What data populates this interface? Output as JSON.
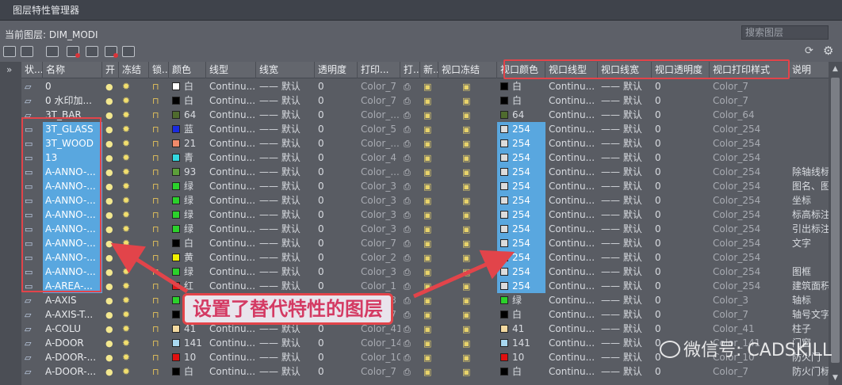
{
  "title": "图层特性管理器",
  "current_layer": "当前图层: DIM_MODI",
  "search_placeholder": "搜索图层",
  "annotation": "设置了替代特性的图层",
  "watermark": "微信号: CADSKILL",
  "columns": [
    {
      "key": "status",
      "label": "状..."
    },
    {
      "key": "name",
      "label": "名称"
    },
    {
      "key": "on",
      "label": "开"
    },
    {
      "key": "freeze",
      "label": "冻结"
    },
    {
      "key": "lock",
      "label": "锁..."
    },
    {
      "key": "color",
      "label": "颜色"
    },
    {
      "key": "linetype",
      "label": "线型"
    },
    {
      "key": "lineweight",
      "label": "线宽"
    },
    {
      "key": "transparency",
      "label": "透明度"
    },
    {
      "key": "plotstyle",
      "label": "打印..."
    },
    {
      "key": "plot",
      "label": "打..."
    },
    {
      "key": "newvp",
      "label": "新..."
    },
    {
      "key": "vpfreeze",
      "label": "视口冻结"
    },
    {
      "key": "vpcolor",
      "label": "视口颜色"
    },
    {
      "key": "vplinetype",
      "label": "视口线型"
    },
    {
      "key": "vplineweight",
      "label": "视口线宽"
    },
    {
      "key": "vptransparency",
      "label": "视口透明度"
    },
    {
      "key": "vpplotstyle",
      "label": "视口打印样式"
    },
    {
      "key": "desc",
      "label": "说明"
    }
  ],
  "rows": [
    {
      "name": "0",
      "override": false,
      "color": "白",
      "color_hex": "#ffffff",
      "linetype": "Continu...",
      "lineweight": "—— 默认",
      "transparency": "0",
      "plotstyle": "Color_7",
      "vpcolor": "白",
      "vpcolor_hex": "#000000",
      "vplinetype": "Continu...",
      "vplineweight": "—— 默认",
      "vptransparency": "0",
      "vpplotstyle": "Color_7",
      "desc": ""
    },
    {
      "name": "0 水印加...",
      "override": false,
      "color": "白",
      "color_hex": "#000000",
      "linetype": "Continu...",
      "lineweight": "—— 默认",
      "transparency": "0",
      "plotstyle": "Color_7",
      "vpcolor": "白",
      "vpcolor_hex": "#000000",
      "vplinetype": "Continu...",
      "vplineweight": "—— 默认",
      "vptransparency": "0",
      "vpplotstyle": "Color_7",
      "desc": ""
    },
    {
      "name": "3T_BAR",
      "override": false,
      "color": "64",
      "color_hex": "#4f6b2e",
      "linetype": "Continu...",
      "lineweight": "—— 默认",
      "transparency": "0",
      "plotstyle": "Color_...",
      "vpcolor": "64",
      "vpcolor_hex": "#4f6b2e",
      "vplinetype": "Continu...",
      "vplineweight": "—— 默认",
      "vptransparency": "0",
      "vpplotstyle": "Color_64",
      "desc": ""
    },
    {
      "name": "3T_GLASS",
      "override": true,
      "color": "蓝",
      "color_hex": "#1a2be0",
      "linetype": "Continu...",
      "lineweight": "—— 默认",
      "transparency": "0",
      "plotstyle": "Color_5",
      "vpcolor": "254",
      "vpcolor_hex": "#dcdcdc",
      "vplinetype": "Continu...",
      "vplineweight": "—— 默认",
      "vptransparency": "0",
      "vpplotstyle": "Color_254",
      "desc": ""
    },
    {
      "name": "3T_WOOD",
      "override": true,
      "color": "21",
      "color_hex": "#f08a6a",
      "linetype": "Continu...",
      "lineweight": "—— 默认",
      "transparency": "0",
      "plotstyle": "Color_...",
      "vpcolor": "254",
      "vpcolor_hex": "#dcdcdc",
      "vplinetype": "Continu...",
      "vplineweight": "—— 默认",
      "vptransparency": "0",
      "vpplotstyle": "Color_254",
      "desc": ""
    },
    {
      "name": "13",
      "override": true,
      "color": "青",
      "color_hex": "#33d8e0",
      "linetype": "Continu...",
      "lineweight": "—— 默认",
      "transparency": "0",
      "plotstyle": "Color_4",
      "vpcolor": "254",
      "vpcolor_hex": "#dcdcdc",
      "vplinetype": "Continu...",
      "vplineweight": "—— 默认",
      "vptransparency": "0",
      "vpplotstyle": "Color_254",
      "desc": ""
    },
    {
      "name": "A-ANNO-...",
      "override": true,
      "color": "93",
      "color_hex": "#5c9f3a",
      "linetype": "Continu...",
      "lineweight": "—— 默认",
      "transparency": "0",
      "plotstyle": "Color_...",
      "vpcolor": "254",
      "vpcolor_hex": "#dcdcdc",
      "vplinetype": "Continu...",
      "vplineweight": "—— 默认",
      "vptransparency": "0",
      "vpplotstyle": "Color_254",
      "desc": "除轴线标"
    },
    {
      "name": "A-ANNO-...",
      "override": true,
      "color": "绿",
      "color_hex": "#2bd12b",
      "linetype": "Continu...",
      "lineweight": "—— 默认",
      "transparency": "0",
      "plotstyle": "Color_3",
      "vpcolor": "254",
      "vpcolor_hex": "#dcdcdc",
      "vplinetype": "Continu...",
      "vplineweight": "—— 默认",
      "vptransparency": "0",
      "vpplotstyle": "Color_254",
      "desc": "图名、图"
    },
    {
      "name": "A-ANNO-...",
      "override": true,
      "color": "绿",
      "color_hex": "#2bd12b",
      "linetype": "Continu...",
      "lineweight": "—— 默认",
      "transparency": "0",
      "plotstyle": "Color_3",
      "vpcolor": "254",
      "vpcolor_hex": "#dcdcdc",
      "vplinetype": "Continu...",
      "vplineweight": "—— 默认",
      "vptransparency": "0",
      "vpplotstyle": "Color_254",
      "desc": "坐标"
    },
    {
      "name": "A-ANNO-...",
      "override": true,
      "color": "绿",
      "color_hex": "#2bd12b",
      "linetype": "Continu...",
      "lineweight": "—— 默认",
      "transparency": "0",
      "plotstyle": "Color_3",
      "vpcolor": "254",
      "vpcolor_hex": "#dcdcdc",
      "vplinetype": "Continu...",
      "vplineweight": "—— 默认",
      "vptransparency": "0",
      "vpplotstyle": "Color_254",
      "desc": "标高标注"
    },
    {
      "name": "A-ANNO-...",
      "override": true,
      "color": "绿",
      "color_hex": "#2bd12b",
      "linetype": "Continu...",
      "lineweight": "—— 默认",
      "transparency": "0",
      "plotstyle": "Color_3",
      "vpcolor": "254",
      "vpcolor_hex": "#dcdcdc",
      "vplinetype": "Continu...",
      "vplineweight": "—— 默认",
      "vptransparency": "0",
      "vpplotstyle": "Color_254",
      "desc": "引出标注"
    },
    {
      "name": "A-ANNO-...",
      "override": true,
      "color": "白",
      "color_hex": "#000000",
      "linetype": "Continu...",
      "lineweight": "—— 默认",
      "transparency": "0",
      "plotstyle": "Color_7",
      "vpcolor": "254",
      "vpcolor_hex": "#dcdcdc",
      "vplinetype": "Continu...",
      "vplineweight": "—— 默认",
      "vptransparency": "0",
      "vpplotstyle": "Color_254",
      "desc": "文字"
    },
    {
      "name": "A-ANNO-...",
      "override": true,
      "color": "黄",
      "color_hex": "#f0f000",
      "linetype": "Continu...",
      "lineweight": "—— 默认",
      "transparency": "0",
      "plotstyle": "Color_2",
      "vpcolor": "254",
      "vpcolor_hex": "#dcdcdc",
      "vplinetype": "Continu...",
      "vplineweight": "—— 默认",
      "vptransparency": "0",
      "vpplotstyle": "Color_254",
      "desc": ""
    },
    {
      "name": "A-ANNO-...",
      "override": true,
      "color": "绿",
      "color_hex": "#2bd12b",
      "linetype": "Continu...",
      "lineweight": "—— 默认",
      "transparency": "0",
      "plotstyle": "Color_3",
      "vpcolor": "254",
      "vpcolor_hex": "#dcdcdc",
      "vplinetype": "Continu...",
      "vplineweight": "—— 默认",
      "vptransparency": "0",
      "vpplotstyle": "Color_254",
      "desc": "图框"
    },
    {
      "name": "A-AREA-...",
      "override": true,
      "color": "红",
      "color_hex": "#e01a1a",
      "linetype": "Continu...",
      "lineweight": "—— 默认",
      "transparency": "0",
      "plotstyle": "Color_1",
      "vpcolor": "254",
      "vpcolor_hex": "#dcdcdc",
      "vplinetype": "Continu...",
      "vplineweight": "—— 默认",
      "vptransparency": "0",
      "vpplotstyle": "Color_254",
      "desc": "建筑面积"
    },
    {
      "name": "A-AXIS",
      "override": false,
      "color": "绿",
      "color_hex": "#2bd12b",
      "linetype": "Continu...",
      "lineweight": "—— 默认",
      "transparency": "0",
      "plotstyle": "Color_3",
      "vpcolor": "绿",
      "vpcolor_hex": "#2bd12b",
      "vplinetype": "Continu...",
      "vplineweight": "—— 默认",
      "vptransparency": "0",
      "vpplotstyle": "Color_3",
      "desc": "轴标"
    },
    {
      "name": "A-AXIS-T...",
      "override": false,
      "color": "白",
      "color_hex": "#000000",
      "linetype": "Continu...",
      "lineweight": "—— 默认",
      "transparency": "0",
      "plotstyle": "Color_7",
      "vpcolor": "白",
      "vpcolor_hex": "#000000",
      "vplinetype": "Continu...",
      "vplineweight": "—— 默认",
      "vptransparency": "0",
      "vpplotstyle": "Color_7",
      "desc": "轴号文字"
    },
    {
      "name": "A-COLU",
      "override": false,
      "color": "41",
      "color_hex": "#f3d9a0",
      "linetype": "Continu...",
      "lineweight": "—— 默认",
      "transparency": "0",
      "plotstyle": "Color_41",
      "vpcolor": "41",
      "vpcolor_hex": "#f3d9a0",
      "vplinetype": "Continu...",
      "vplineweight": "—— 默认",
      "vptransparency": "0",
      "vpplotstyle": "Color_41",
      "desc": "柱子"
    },
    {
      "name": "A-DOOR",
      "override": false,
      "color": "141",
      "color_hex": "#a8d8f0",
      "linetype": "Continu...",
      "lineweight": "—— 默认",
      "transparency": "0",
      "plotstyle": "Color_141",
      "vpcolor": "141",
      "vpcolor_hex": "#a8d8f0",
      "vplinetype": "Continu...",
      "vplineweight": "—— 默认",
      "vptransparency": "0",
      "vpplotstyle": "Color_141",
      "desc": "门窗"
    },
    {
      "name": "A-DOOR-...",
      "override": false,
      "color": "10",
      "color_hex": "#e01010",
      "linetype": "Continu...",
      "lineweight": "—— 默认",
      "transparency": "0",
      "plotstyle": "Color_10",
      "vpcolor": "10",
      "vpcolor_hex": "#e01010",
      "vplinetype": "Continu...",
      "vplineweight": "—— 默认",
      "vptransparency": "0",
      "vpplotstyle": "Color_10",
      "desc": "防火门"
    },
    {
      "name": "A-DOOR-...",
      "override": false,
      "color": "白",
      "color_hex": "#000000",
      "linetype": "Continu...",
      "lineweight": "—— 默认",
      "transparency": "0",
      "plotstyle": "Color_7",
      "vpcolor": "白",
      "vpcolor_hex": "#000000",
      "vplinetype": "Continu...",
      "vplineweight": "—— 默认",
      "vptransparency": "0",
      "vpplotstyle": "Color_7",
      "desc": "防火门标"
    }
  ]
}
